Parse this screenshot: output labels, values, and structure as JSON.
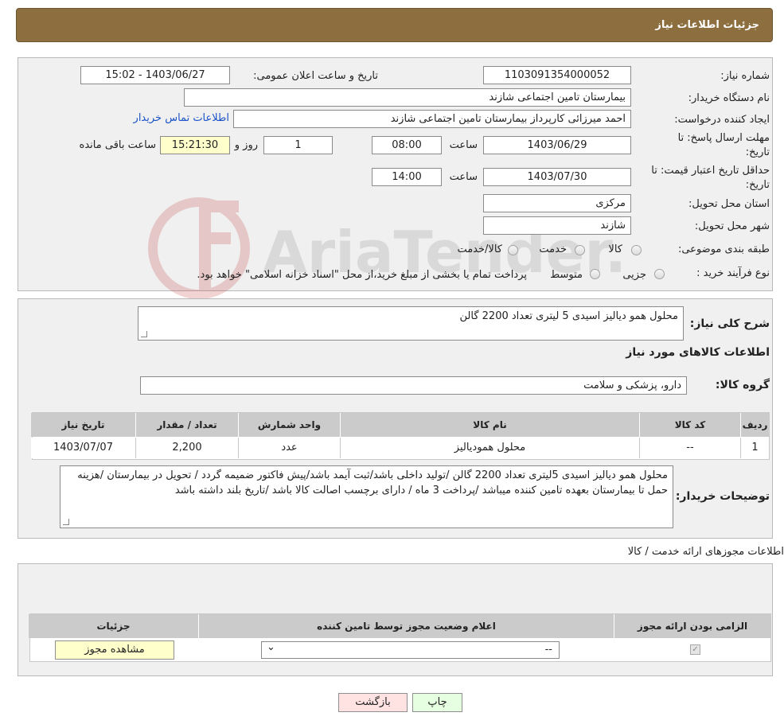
{
  "header": {
    "title": "جزئیات اطلاعات نیاز"
  },
  "form": {
    "need_number_label": "شماره نیاز:",
    "need_number": "1103091354000052",
    "announce_label": "تاریخ و ساعت اعلان عمومی:",
    "announce_value": "1403/06/27 - 15:02",
    "buyer_org_label": "نام دستگاه خریدار:",
    "buyer_org": "بیمارستان تامین اجتماعی شازند",
    "requester_label": "ایجاد کننده درخواست:",
    "requester": "احمد میرزائی کارپرداز بیمارستان تامین اجتماعی شازند",
    "contact_link": "اطلاعات تماس خریدار",
    "deadline_label": "مهلت ارسال پاسخ: تا",
    "deadline_label2": "تاریخ:",
    "deadline_date": "1403/06/29",
    "time_label": "ساعت",
    "deadline_time": "08:00",
    "days_value": "1",
    "days_label": "روز و",
    "remaining_time": "15:21:30",
    "remaining_label": "ساعت باقی مانده",
    "price_valid_label": "حداقل تاریخ اعتبار قیمت: تا",
    "price_valid_label2": "تاریخ:",
    "price_valid_date": "1403/07/30",
    "price_valid_time": "14:00",
    "province_label": "استان محل تحویل:",
    "province": "مرکزی",
    "city_label": "شهر محل تحویل:",
    "city": "شازند",
    "category_label": "طبقه بندی موضوعی:",
    "cat_goods": "کالا",
    "cat_service": "خدمت",
    "cat_both": "کالا/خدمت",
    "process_label": "نوع فرآیند خرید :",
    "proc_partial": "جزیی",
    "proc_medium": "متوسط",
    "process_note": "پرداخت تمام یا بخشی از مبلغ خرید،از محل \"اسناد خزانه اسلامی\" خواهد بود."
  },
  "general": {
    "desc_label": "شرح کلی نیاز:",
    "desc_value": "محلول همو دیالیز اسیدی 5 لیتری  تعداد 2200 گالن",
    "goods_info_title": "اطلاعات کالاهای مورد نیاز",
    "group_label": "گروه کالا:",
    "group_value": "دارو، پزشکی و سلامت"
  },
  "goods_table": {
    "headers": [
      "ردیف",
      "کد کالا",
      "نام کالا",
      "واحد شمارش",
      "تعداد / مقدار",
      "تاریخ نیاز"
    ],
    "rows": [
      [
        "1",
        "--",
        "محلول همودیالیز",
        "عدد",
        "2,200",
        "1403/07/07"
      ]
    ]
  },
  "buyer_notes": {
    "label": "توضیحات خریدار:",
    "text": "محلول همو دیالیز اسیدی 5لیتری تعداد 2200 گالن /تولید داخلی باشد/ثبت آیمد باشد/پیش فاکتور ضمیمه گردد / تحویل در بیمارستان /هزینه حمل تا بیمارستان بعهده تامین کننده میباشد /پرداخت 3 ماه / دارای برچسب اصالت کالا باشد /تاریخ بلند داشته باشد"
  },
  "permits": {
    "section_title": "اطلاعات مجوزهای ارائه خدمت / کالا",
    "headers": [
      "الزامی بودن ارائه مجوز",
      "اعلام وضعیت مجوز توسط تامین کننده",
      "جزئیات"
    ],
    "select_value": "--",
    "view_button": "مشاهده مجوز"
  },
  "footer": {
    "print_button": "چاپ",
    "back_button": "بازگشت"
  },
  "watermark": {
    "text": "AriaTender.neT"
  }
}
